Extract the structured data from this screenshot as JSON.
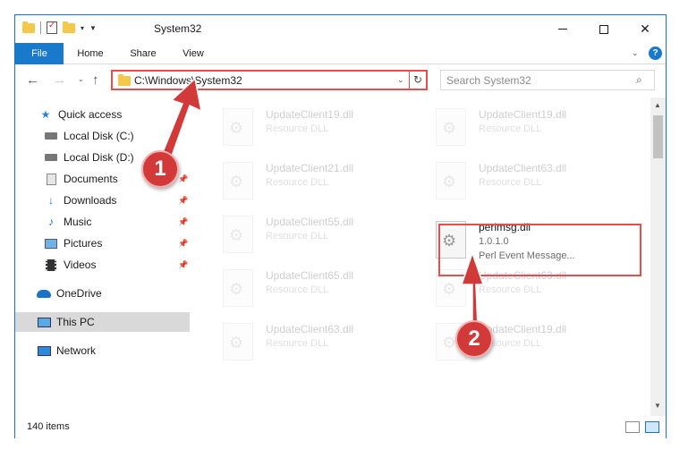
{
  "window": {
    "title": "System32",
    "controls": {
      "minimize": "",
      "maximize": "",
      "close": "✕"
    }
  },
  "ribbon": {
    "tabs": [
      "File",
      "Home",
      "Share",
      "View"
    ],
    "help": "?"
  },
  "address": {
    "path": "C:\\Windows\\System32",
    "search_placeholder": "Search System32"
  },
  "nav": {
    "items": [
      {
        "label": "Quick access",
        "icon": "star-icon"
      },
      {
        "label": "Local Disk (C:)",
        "icon": "drive-icon"
      },
      {
        "label": "Local Disk (D:)",
        "icon": "drive-icon"
      },
      {
        "label": "Documents",
        "icon": "documents-icon",
        "pinned": true
      },
      {
        "label": "Downloads",
        "icon": "downloads-icon",
        "pinned": true
      },
      {
        "label": "Music",
        "icon": "music-icon",
        "pinned": true
      },
      {
        "label": "Pictures",
        "icon": "pictures-icon",
        "pinned": true
      },
      {
        "label": "Videos",
        "icon": "videos-icon",
        "pinned": true
      },
      {
        "label": "OneDrive",
        "icon": "onedrive-icon"
      },
      {
        "label": "This PC",
        "icon": "this-pc-icon",
        "selected": true
      },
      {
        "label": "Network",
        "icon": "network-icon"
      }
    ]
  },
  "files": [
    {
      "name": "UpdateClient19.dll",
      "desc": "Resource DLL",
      "faded": true
    },
    {
      "name": "UpdateClient19.dll",
      "desc": "Resource DLL",
      "faded": true
    },
    {
      "name": "UpdateClient21.dll",
      "desc": "Resource DLL",
      "faded": true
    },
    {
      "name": "UpdateClient63.dll",
      "desc": "Resource DLL",
      "faded": true
    },
    {
      "name": "UpdateClient55.dll",
      "desc": "Resource DLL",
      "faded": true
    },
    {
      "name": "perlmsg.dll",
      "desc": "1.0.1.0",
      "desc2": "Perl Event Message...",
      "faded": false
    },
    {
      "name": "UpdateClient65.dll",
      "desc": "Resource DLL",
      "faded": true
    },
    {
      "name": "UpdateClient63.dll",
      "desc": "Resource DLL",
      "faded": true
    },
    {
      "name": "UpdateClient63.dll",
      "desc": "Resource DLL",
      "faded": true
    },
    {
      "name": "UpdateClient19.dll",
      "desc": "Resource DLL",
      "faded": true
    }
  ],
  "status": {
    "items": "140 items"
  },
  "callouts": {
    "step1": "1",
    "step2": "2"
  },
  "colors": {
    "accent": "#1979ca",
    "highlight": "#e05050",
    "callout": "#d23a3a"
  }
}
